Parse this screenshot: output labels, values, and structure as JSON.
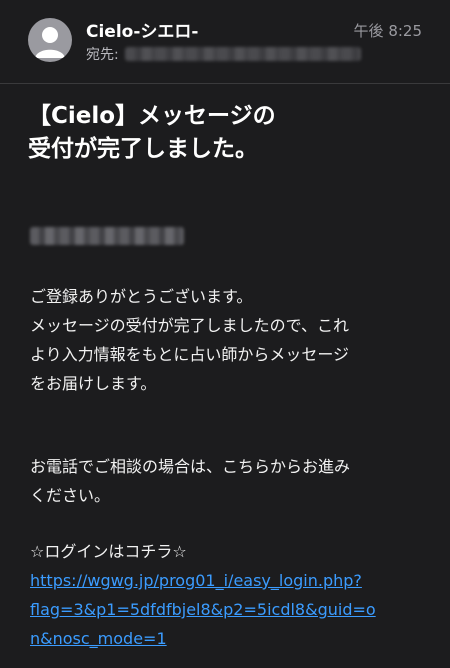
{
  "header": {
    "sender_name": "Cielo-シエロ-",
    "to_label": "宛先:",
    "time": "午後 8:25",
    "avatar_icon": "person-icon"
  },
  "subject": {
    "line1": "【Cielo】メッセージの",
    "line2": "受付が完了しました。"
  },
  "body": {
    "paragraph1": [
      "ご登録ありがとうございます。",
      "メッセージの受付が完了しましたので、これ",
      "より入力情報をもとに占い師からメッセージ",
      "をお届けします。"
    ],
    "paragraph2": [
      "お電話でご相談の場合は、こちらからお進み",
      "ください。"
    ],
    "login_heading": "☆ログインはコチラ☆",
    "link_lines": [
      "https://wgwg.jp/prog01_i/easy_login.php?",
      "flag=3&p1=5dfdfbjel8&p2=5icdl8&guid=o",
      "n&nosc_mode=1"
    ]
  },
  "colors": {
    "background": "#1c1c1e",
    "link": "#3b9cff",
    "secondary_text": "#9a9aa0"
  }
}
